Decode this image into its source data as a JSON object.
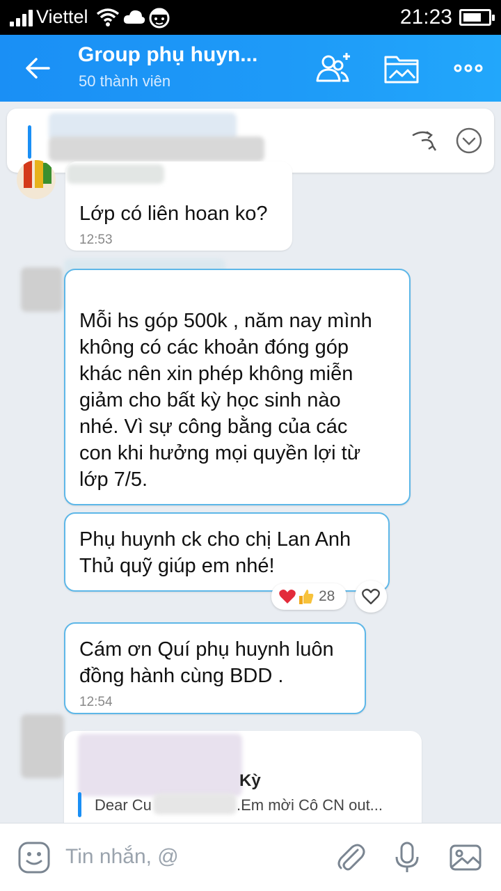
{
  "status_bar": {
    "carrier": "Viettel",
    "time": "21:23"
  },
  "header": {
    "title": "Group phụ huyn...",
    "subtitle": "50 thành viên",
    "accent_color": "#1a8ff5"
  },
  "messages": [
    {
      "text": "Lớp có liên hoan ko?",
      "time": "12:53"
    },
    {
      "text": "Mỗi hs góp 500k , năm nay mình\nkhông có các khoản đóng góp\nkhác nên xin phép không miễn\ngiảm cho bất kỳ học sinh nào\nnhé. Vì sự công bằng của các\ncon khi hưởng mọi quyền lợi từ\nlớp 7/5."
    },
    {
      "text": "Phụ huynh ck cho chị Lan Anh\nThủ quỹ giúp em nhé!",
      "reactions": {
        "icons": [
          "heart-icon",
          "thumbs-up-icon"
        ],
        "count": "28"
      }
    },
    {
      "text": "Cám ơn Quí phụ huynh luôn\nđồng hành cùng BDD .",
      "time": "12:54"
    }
  ],
  "quoted": {
    "name_tail": "Kỳ",
    "preview_start": "Dear Cu",
    "preview_end": ".Em mời Cô CN out..."
  },
  "input": {
    "placeholder": "Tin nhắn, @"
  }
}
